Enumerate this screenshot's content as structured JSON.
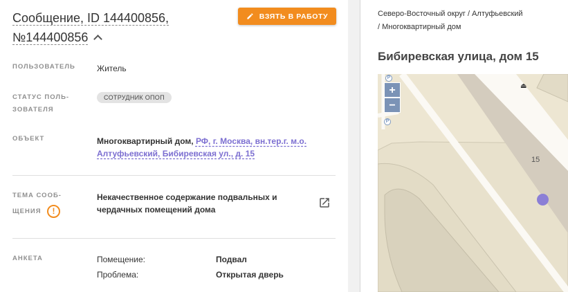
{
  "header": {
    "title_line1": "Сообщение, ID 144400856,",
    "title_line2": "№144400856",
    "take_button": "Взять в работу"
  },
  "fields": {
    "user_label": "Пользователь",
    "user_value": "Житель",
    "status_label": "Статус поль-\nзователя",
    "status_value": "Сотрудник ОПОП",
    "object_label": "Объект",
    "object_prefix": "Многоквартирный дом, ",
    "object_link": "РФ, г. Москва, вн.тер.г. м.о. Алтуфьевский, Бибиревская ул., д. 15",
    "topic_label_1": "Тема сооб-",
    "topic_label_2": "щения",
    "topic_value": "Некачественное содержание подвальных и чердачных помещений дома",
    "survey_label": "Анкета",
    "survey": [
      {
        "key": "Помещение:",
        "value": "Подвал"
      },
      {
        "key": "Проблема:",
        "value": "Открытая дверь"
      }
    ]
  },
  "right": {
    "breadcrumb_1": "Северо-Восточный округ / Алтуфьевский",
    "breadcrumb_2": "/ Многоквартирный дом",
    "address": "Бибиревская улица, дом 15"
  },
  "map": {
    "zoom_in": "+",
    "zoom_out": "−",
    "building_number": "15",
    "parking_label": "P",
    "poi_glyph": "⏏",
    "marker_color": "#8b7fd6"
  },
  "colors": {
    "accent": "#f28c1e",
    "link": "#7c6fd1"
  }
}
